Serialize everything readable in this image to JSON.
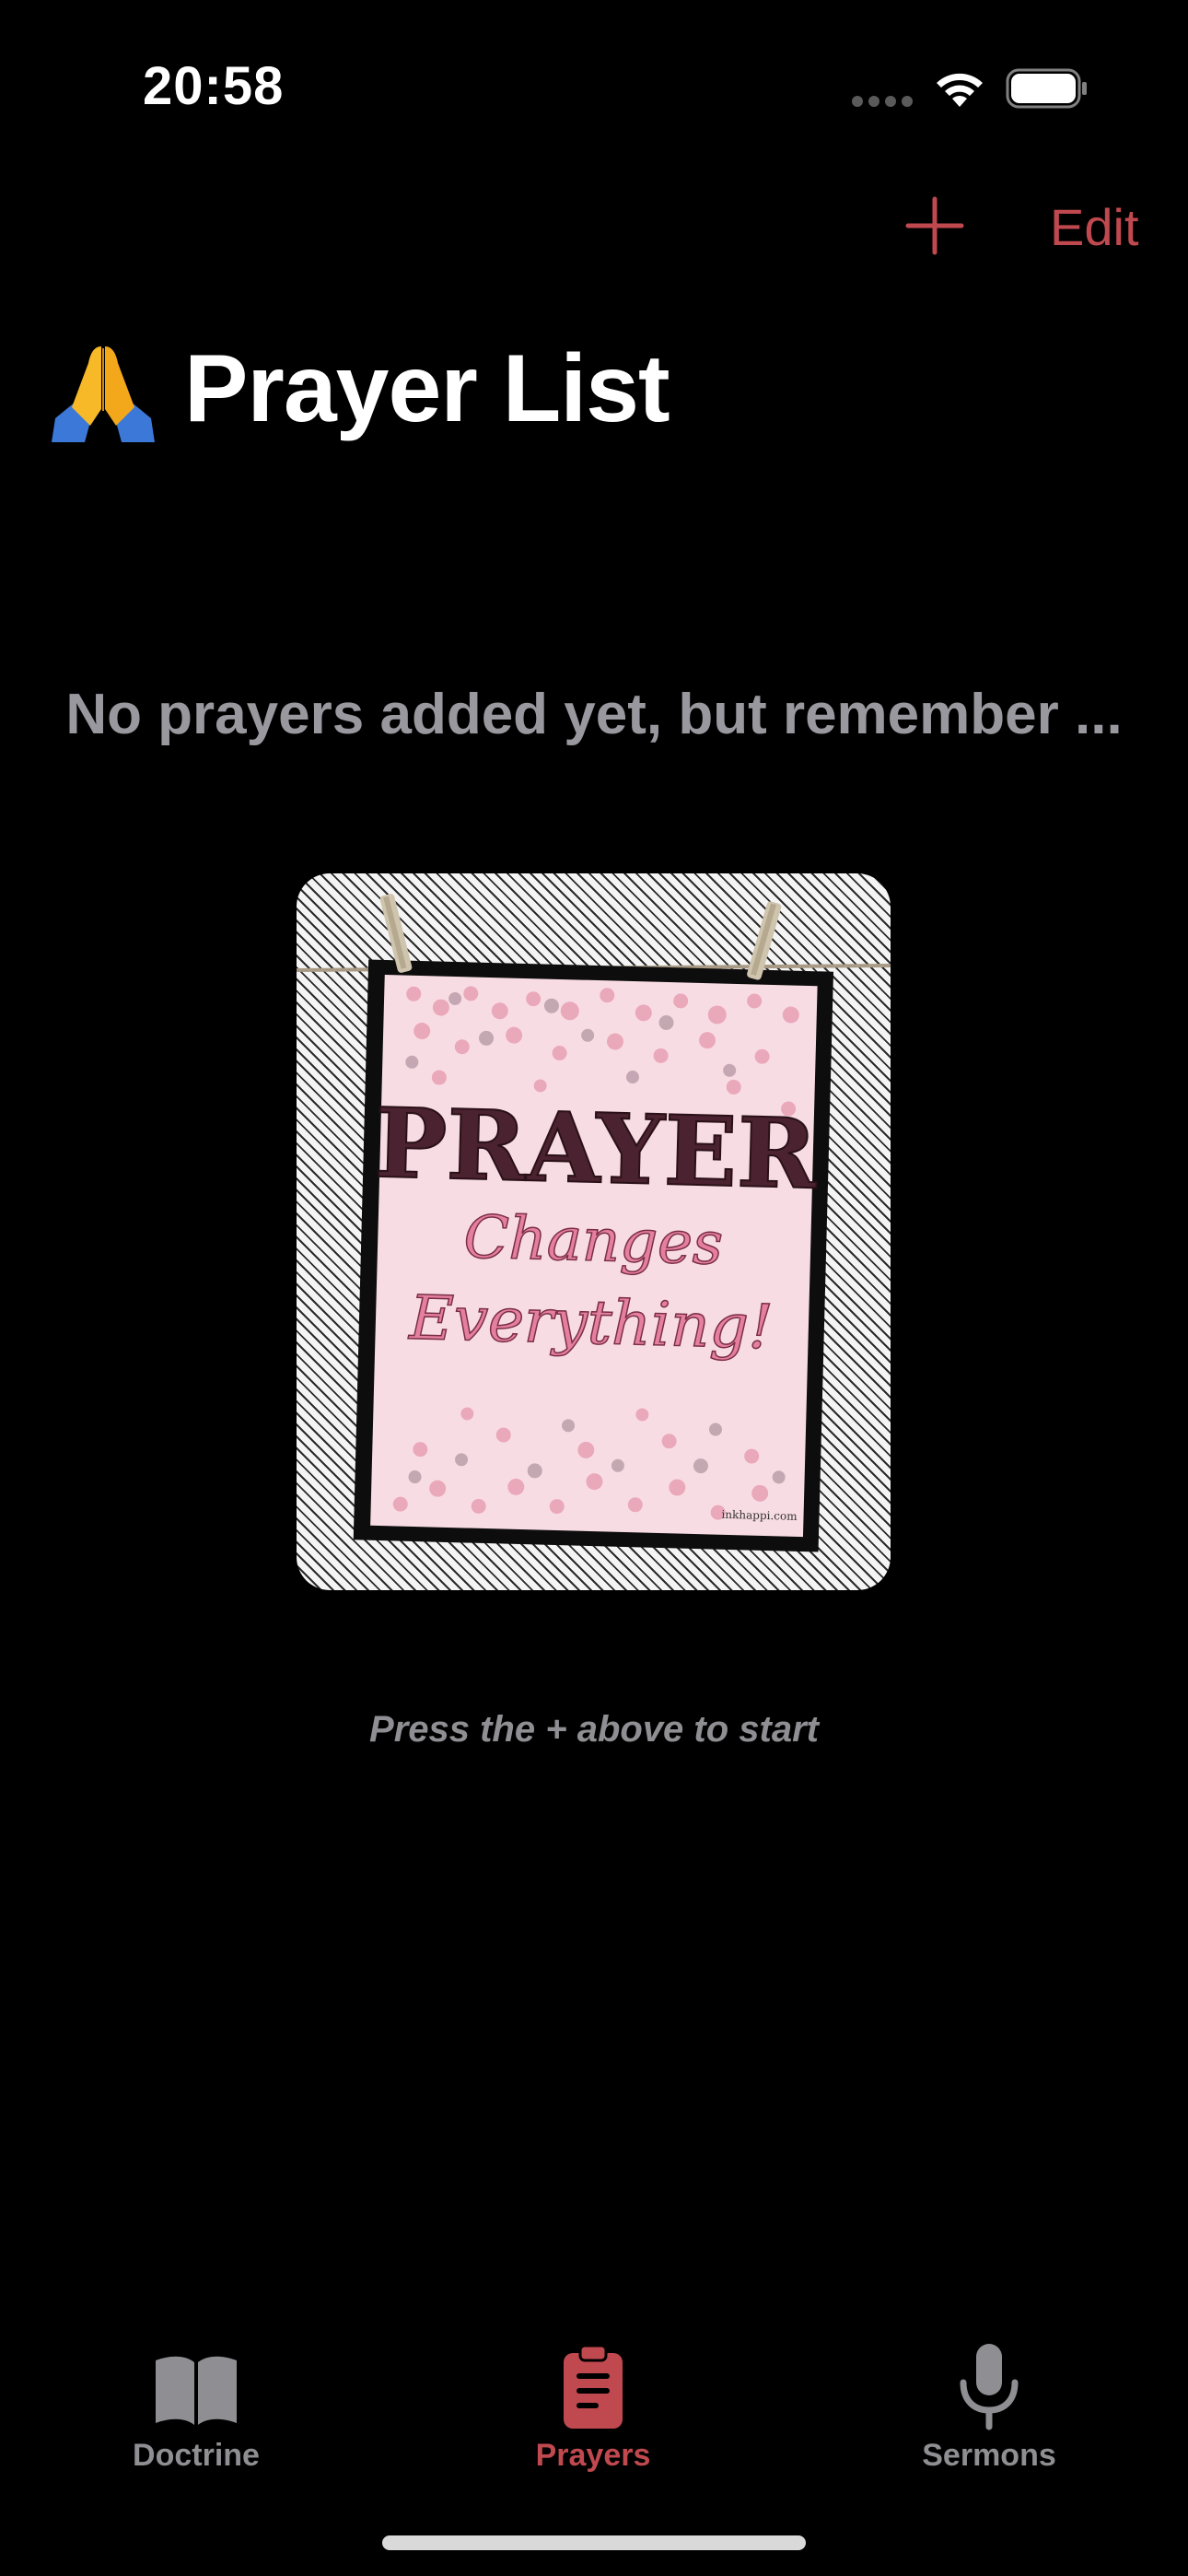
{
  "status_bar": {
    "time": "20:58",
    "signal_icon": "cellular-signal-icon",
    "wifi_icon": "wifi-icon",
    "battery_icon": "battery-icon"
  },
  "nav_bar": {
    "add_icon": "plus-icon",
    "edit_label": "Edit",
    "tint_color": "#c0494f"
  },
  "header": {
    "title_icon": "folded-hands-emoji",
    "title": "Prayer List"
  },
  "empty_state": {
    "message": "No prayers added yet, but remember ...",
    "poster": {
      "line1": "PRAYER",
      "line2": "Changes",
      "line3": "Everything!",
      "credit": "inkhappi.com"
    },
    "hint": "Press the + above to start"
  },
  "tab_bar": {
    "items": [
      {
        "label": "Doctrine",
        "icon": "book-icon",
        "active": false
      },
      {
        "label": "Prayers",
        "icon": "clipboard-icon",
        "active": true
      },
      {
        "label": "Sermons",
        "icon": "microphone-icon",
        "active": false
      }
    ],
    "active_color": "#c0494f",
    "inactive_color": "#8e8e93"
  }
}
